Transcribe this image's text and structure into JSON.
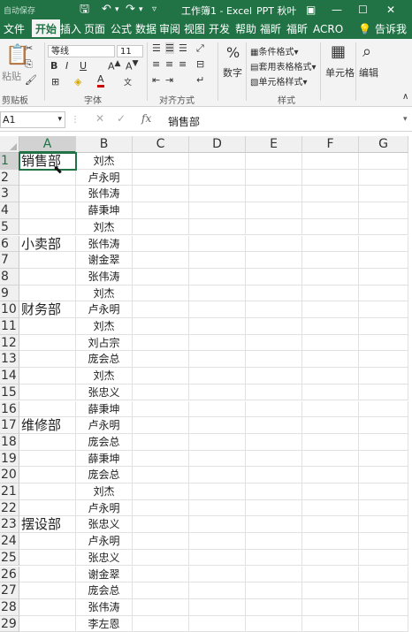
{
  "titlebar": {
    "autosave": "自动保存",
    "title": "工作簿1 - Excel",
    "user": "PPT 秋叶"
  },
  "tabs": [
    "文件",
    "开始",
    "插入",
    "页面",
    "公式",
    "数据",
    "审阅",
    "视图",
    "开发",
    "帮助",
    "福昕",
    "福昕",
    "ACRO"
  ],
  "tell_me": "告诉我",
  "ribbon": {
    "paste": "粘贴",
    "clipboard": "剪贴板",
    "font_name": "等线",
    "font_size": "11",
    "bold": "B",
    "italic": "I",
    "underline": "U",
    "font_group": "字体",
    "align_group": "对齐方式",
    "number": "数字",
    "percent": "%",
    "cond_format": "条件格式",
    "table_format": "套用表格格式",
    "cell_style": "单元格样式",
    "styles_group": "样式",
    "cells": "单元格",
    "editing": "编辑"
  },
  "formula_bar": {
    "name_box": "A1",
    "fx": "fx",
    "content": "销售部"
  },
  "columns": [
    "A",
    "B",
    "C",
    "D",
    "E",
    "F",
    "G"
  ],
  "rows": [
    {
      "n": "1",
      "a": "销售部",
      "b": "刘杰"
    },
    {
      "n": "2",
      "a": "",
      "b": "卢永明"
    },
    {
      "n": "3",
      "a": "",
      "b": "张伟涛"
    },
    {
      "n": "4",
      "a": "",
      "b": "薛秉坤"
    },
    {
      "n": "5",
      "a": "",
      "b": "刘杰"
    },
    {
      "n": "6",
      "a": "小卖部",
      "b": "张伟涛"
    },
    {
      "n": "7",
      "a": "",
      "b": "谢金翠"
    },
    {
      "n": "8",
      "a": "",
      "b": "张伟涛"
    },
    {
      "n": "9",
      "a": "",
      "b": "刘杰"
    },
    {
      "n": "10",
      "a": "财务部",
      "b": "卢永明"
    },
    {
      "n": "11",
      "a": "",
      "b": "刘杰"
    },
    {
      "n": "12",
      "a": "",
      "b": "刘占宗"
    },
    {
      "n": "13",
      "a": "",
      "b": "庞会总"
    },
    {
      "n": "14",
      "a": "",
      "b": "刘杰"
    },
    {
      "n": "15",
      "a": "",
      "b": "张忠义"
    },
    {
      "n": "16",
      "a": "",
      "b": "薛秉坤"
    },
    {
      "n": "17",
      "a": "维修部",
      "b": "卢永明"
    },
    {
      "n": "18",
      "a": "",
      "b": "庞会总"
    },
    {
      "n": "19",
      "a": "",
      "b": "薛秉坤"
    },
    {
      "n": "20",
      "a": "",
      "b": "庞会总"
    },
    {
      "n": "21",
      "a": "",
      "b": "刘杰"
    },
    {
      "n": "22",
      "a": "",
      "b": "卢永明"
    },
    {
      "n": "23",
      "a": "摆设部",
      "b": "张忠义"
    },
    {
      "n": "24",
      "a": "",
      "b": "卢永明"
    },
    {
      "n": "25",
      "a": "",
      "b": "张忠义"
    },
    {
      "n": "26",
      "a": "",
      "b": "谢金翠"
    },
    {
      "n": "27",
      "a": "",
      "b": "庞会总"
    },
    {
      "n": "28",
      "a": "",
      "b": "张伟涛"
    },
    {
      "n": "29",
      "a": "",
      "b": "李左恩"
    }
  ]
}
